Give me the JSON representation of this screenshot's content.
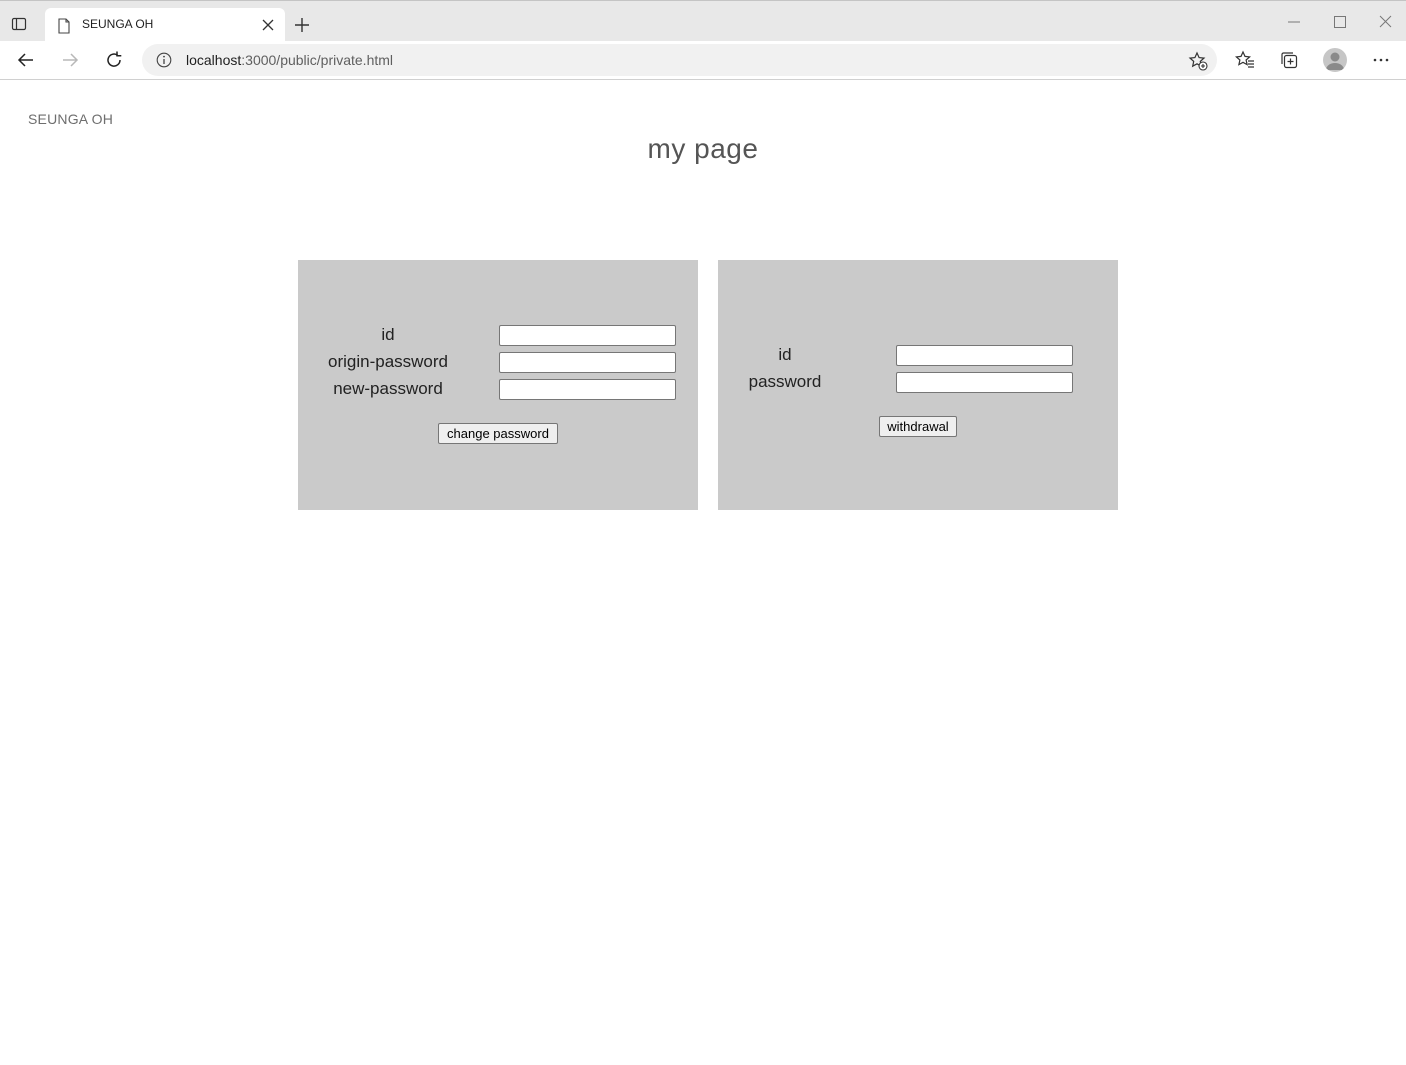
{
  "browser": {
    "tab_title": "SEUNGA OH",
    "url_host": "localhost",
    "url_path": ":3000/public/private.html"
  },
  "page": {
    "site_name": "SEUNGA OH",
    "title": "my page"
  },
  "change_password_form": {
    "fields": [
      {
        "label": "id",
        "value": ""
      },
      {
        "label": "origin-password",
        "value": ""
      },
      {
        "label": "new-password",
        "value": ""
      }
    ],
    "submit_label": "change password"
  },
  "withdrawal_form": {
    "fields": [
      {
        "label": "id",
        "value": ""
      },
      {
        "label": "password",
        "value": ""
      }
    ],
    "submit_label": "withdrawal"
  },
  "colors": {
    "panel_bg": "#cacaca",
    "chrome_bg": "#e8e8e8"
  },
  "icons": [
    "tab-actions-icon",
    "page-icon",
    "close-icon",
    "plus-icon",
    "minimize-icon",
    "maximize-icon",
    "back-arrow-icon",
    "forward-arrow-icon",
    "refresh-icon",
    "info-icon",
    "add-favorite-icon",
    "favorites-icon",
    "collections-icon",
    "profile-icon",
    "more-icon"
  ]
}
